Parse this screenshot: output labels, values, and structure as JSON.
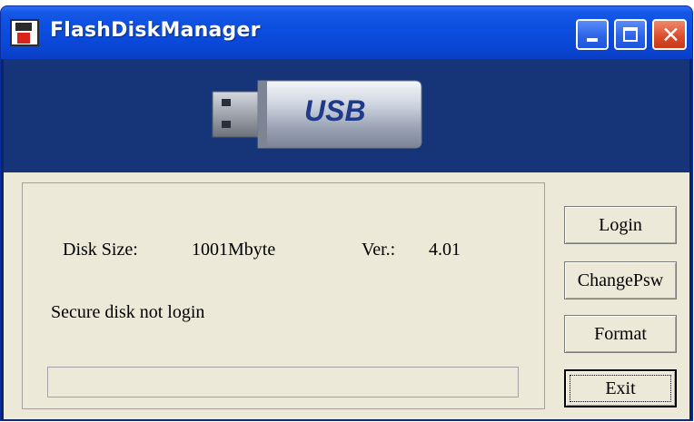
{
  "window": {
    "title": "FlashDiskManager"
  },
  "titlebar": {
    "app_icon": "floppy-disk-icon",
    "buttons": {
      "minimize": "minimize-icon",
      "maximize": "maximize-icon",
      "close": "close-icon"
    },
    "close_glyph": "✕"
  },
  "banner": {
    "label": "USB"
  },
  "info": {
    "disk_size_label": "Disk Size:",
    "disk_size_value": "1001Mbyte",
    "version_label": "Ver.:",
    "version_value": "4.01",
    "status_text": "Secure disk not login"
  },
  "progress": {
    "value": 0
  },
  "actions": {
    "login": "Login",
    "change_password": "ChangePsw",
    "format": "Format",
    "exit": "Exit"
  },
  "colors": {
    "titlebar": "#0c4fe0",
    "banner_bg": "#163478",
    "client_bg": "#ece9d8",
    "close_button": "#dd4a2a"
  }
}
